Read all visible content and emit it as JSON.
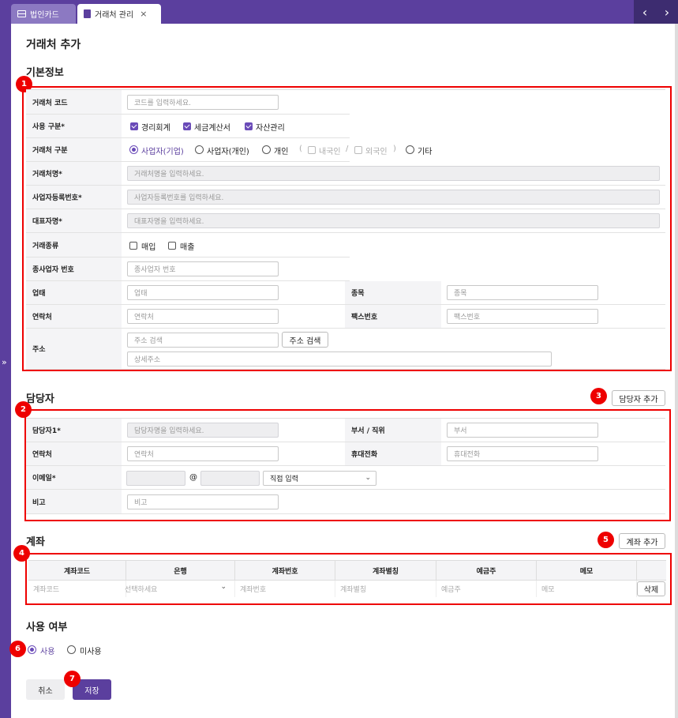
{
  "tabs": [
    {
      "label": "법인카드",
      "icon": "card-icon",
      "active": false
    },
    {
      "label": "거래처 관리",
      "icon": "document-icon",
      "active": true
    }
  ],
  "page_title": "거래처 추가",
  "sections": {
    "basic": "기본정보",
    "manager": "담당자",
    "account": "계좌",
    "usage": "사용 여부"
  },
  "badges": [
    "1",
    "2",
    "3",
    "4",
    "5",
    "6",
    "7"
  ],
  "basic": {
    "code_label": "거래처 코드",
    "code_placeholder": "코드를 입력하세요.",
    "usage_label": "사용 구분*",
    "usage_options": [
      "경리회계",
      "세금계산서",
      "자산관리"
    ],
    "type_label": "거래처 구분",
    "type_options": [
      "사업자(기업)",
      "사업자(개인)",
      "개인",
      "내국인",
      "외국인",
      "기타"
    ],
    "type_paren_open": "(",
    "type_paren_slash": "/",
    "type_paren_close": ")",
    "name_label": "거래처명*",
    "name_placeholder": "거래처명을 입력하세요.",
    "bizno_label": "사업자등록번호*",
    "bizno_placeholder": "사업자등록번호를 입력하세요.",
    "ceo_label": "대표자명*",
    "ceo_placeholder": "대표자명을 입력하세요.",
    "trade_label": "거래종류",
    "trade_options": [
      "매입",
      "매출"
    ],
    "subbiz_label": "종사업자 번호",
    "subbiz_placeholder": "종사업자 번호",
    "biztype_label": "업태",
    "biztype_placeholder": "업태",
    "item_label": "종목",
    "item_placeholder": "종목",
    "contact_label": "연락처",
    "contact_placeholder": "연락처",
    "fax_label": "팩스번호",
    "fax_placeholder": "팩스번호",
    "addr_label": "주소",
    "addr_placeholder": "주소 검색",
    "addr_button": "주소 검색",
    "addr_detail_placeholder": "상세주소"
  },
  "manager": {
    "add_button": "담당자 추가",
    "name_label": "담당자1*",
    "name_placeholder": "담당자명을 입력하세요.",
    "dept_label": "부서 / 직위",
    "dept_placeholder": "부서",
    "contact_label": "연락처",
    "contact_placeholder": "연락처",
    "mobile_label": "휴대전화",
    "mobile_placeholder": "휴대전화",
    "email_label": "이메일*",
    "email_at": "@",
    "email_select": "직접 입력",
    "note_label": "비고",
    "note_placeholder": "비고"
  },
  "account": {
    "add_button": "계좌 추가",
    "headers": [
      "계좌코드",
      "은행",
      "계좌번호",
      "계좌별칭",
      "예금주",
      "메모"
    ],
    "row": [
      "계좌코드",
      "선택하세요",
      "계좌번호",
      "계좌별칭",
      "예금주",
      "메모"
    ],
    "delete_button": "삭제"
  },
  "usage": {
    "options": [
      "사용",
      "미사용"
    ],
    "selected": "사용"
  },
  "footer": {
    "cancel": "취소",
    "save": "저장"
  },
  "colors": {
    "brand": "#5b3f9e",
    "highlight": "#e00000"
  }
}
